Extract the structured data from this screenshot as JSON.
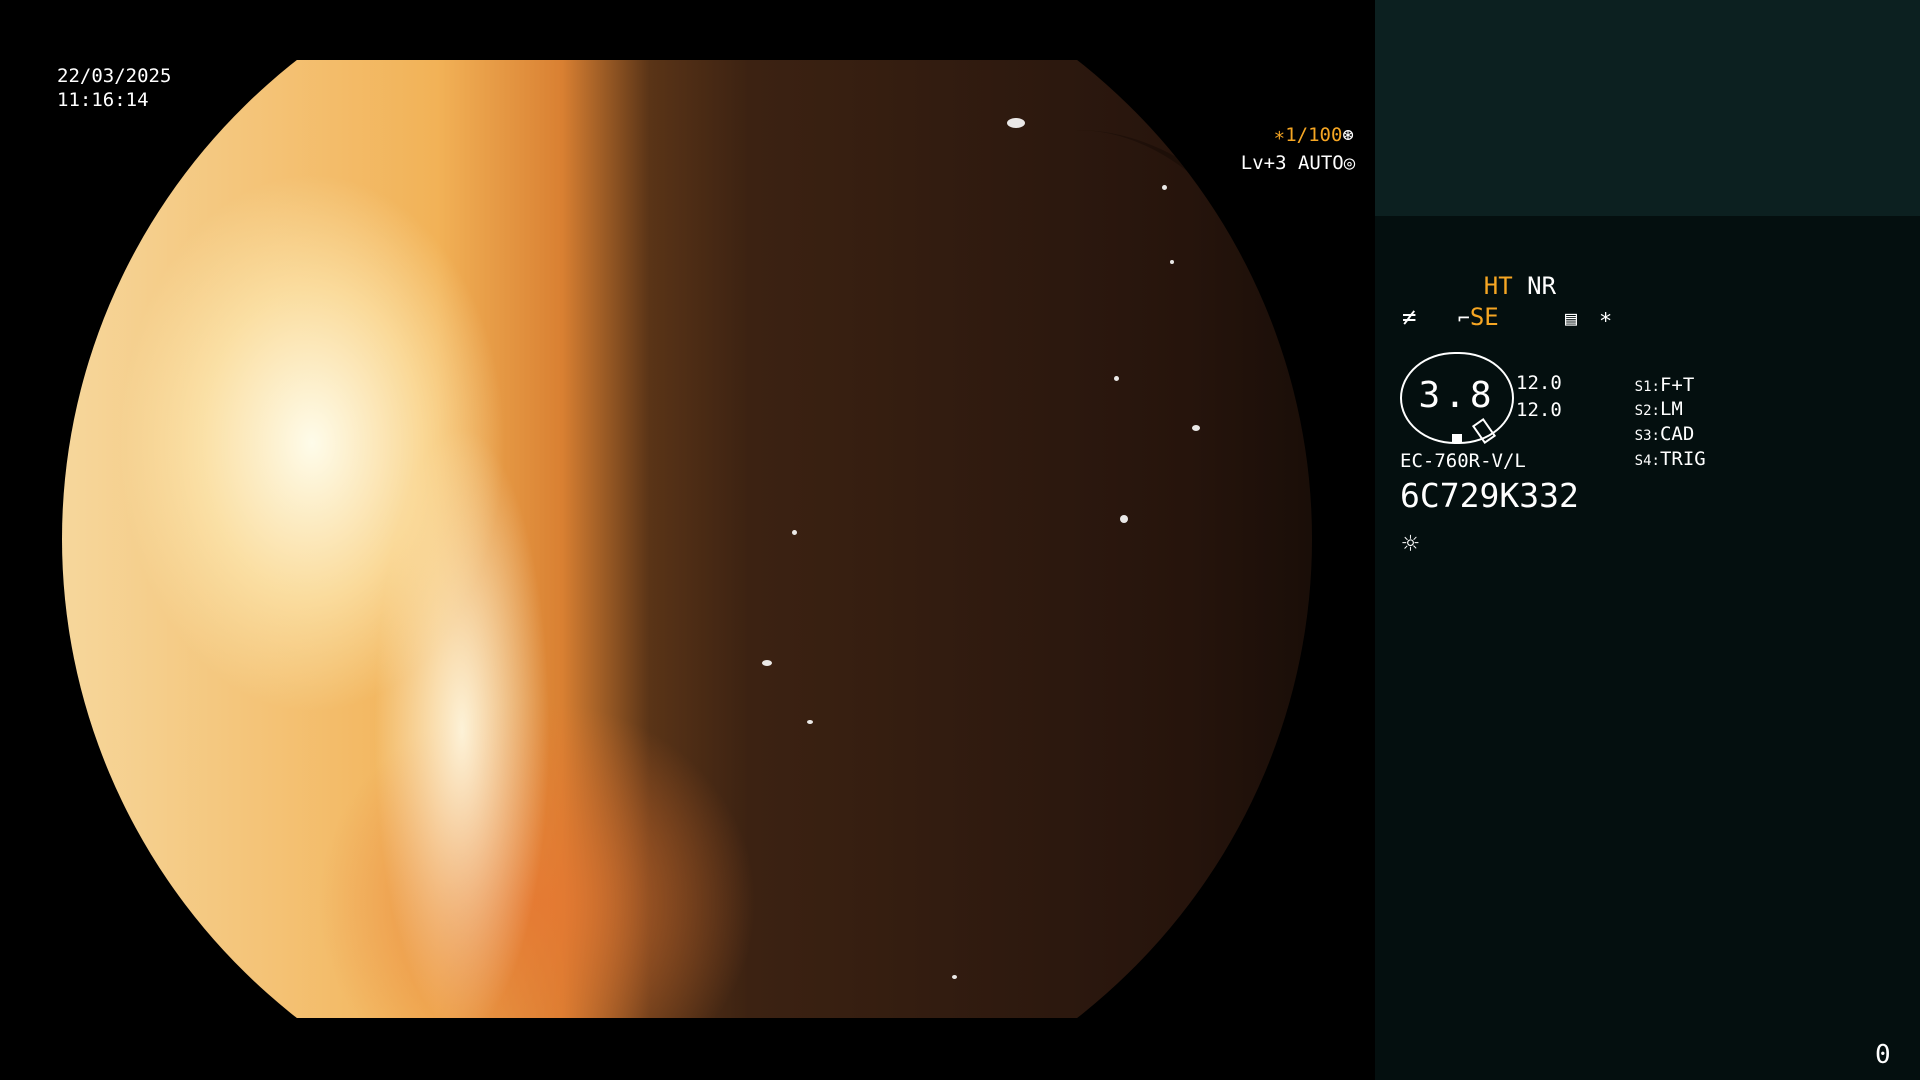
{
  "timestamp": {
    "date": "22/03/2025",
    "time": "11:16:14"
  },
  "shutter": {
    "value": "∗1/100",
    "icon": "iris-icon"
  },
  "level": {
    "value": "Lv+3 AUTO",
    "icon": "auto-iris-icon"
  },
  "panel": {
    "ht_label": "HT",
    "nr_label": "NR",
    "se_prefix_icon": "scope-icon",
    "se_label": "SE",
    "freeze_icon": "slash-f-icon",
    "memo_icon": "memo-icon",
    "asterisk": "∗",
    "gauge_value": "3.8",
    "gauge_upper": "12.0",
    "gauge_lower": "12.0",
    "switches": [
      {
        "key": "S1:",
        "value": "F+T"
      },
      {
        "key": "S2:",
        "value": "LM"
      },
      {
        "key": "S3:",
        "value": "CAD"
      },
      {
        "key": "S4:",
        "value": "TRIG"
      }
    ],
    "model": "EC-760R-V/L",
    "serial": "6C729K332",
    "light_icon": "light-source-icon",
    "counter": "0"
  },
  "colors": {
    "accent_orange": "#f6a623",
    "panel_bg": "#040f0f",
    "panel_header_bg": "#0c2020"
  }
}
